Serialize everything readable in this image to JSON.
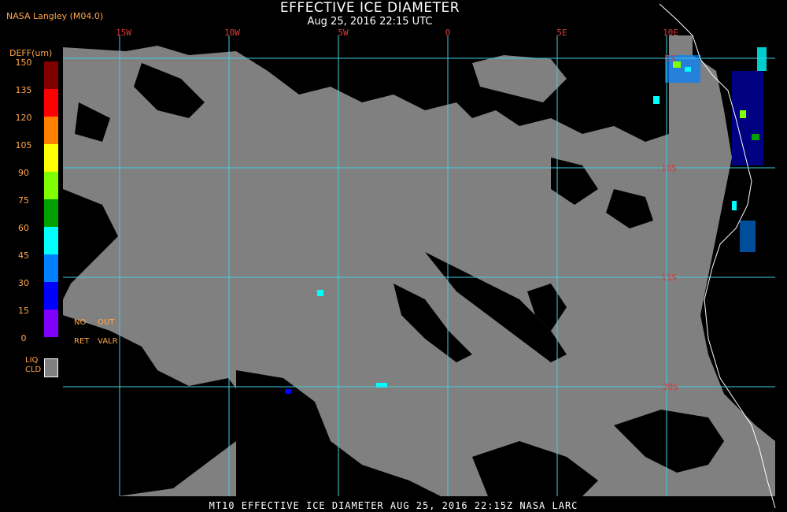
{
  "header": {
    "title": "EFFECTIVE ICE DIAMETER",
    "subtitle": "Aug 25, 2016 22:15 UTC",
    "source": "NASA Langley (M04.0)"
  },
  "legend": {
    "title": "DEFF(um)",
    "ticks": [
      "150",
      "135",
      "120",
      "105",
      "90",
      "75",
      "60",
      "45",
      "30",
      "15",
      "0"
    ],
    "colors": [
      "#800000",
      "#ff0000",
      "#ff8000",
      "#ffff00",
      "#80ff00",
      "#00a000",
      "#00ffff",
      "#0080ff",
      "#0000ff",
      "#8000ff"
    ],
    "no_ret": [
      "NO",
      "RET"
    ],
    "out_valr": [
      "OUT",
      "VALR"
    ],
    "liq_cld": [
      "LIQ",
      "CLD"
    ]
  },
  "grid": {
    "lon_labels": [
      "15W",
      "10W",
      "5W",
      "0",
      "5E",
      "10E"
    ],
    "lat_labels": [
      "5S",
      "10S",
      "15S",
      "20S"
    ],
    "line_color": "#40d0e0",
    "label_color": "#d83a3a"
  },
  "footer": {
    "text": "MT10  EFFECTIVE ICE DIAMETER   AUG 25, 2016 22:15Z   NASA LARC"
  }
}
